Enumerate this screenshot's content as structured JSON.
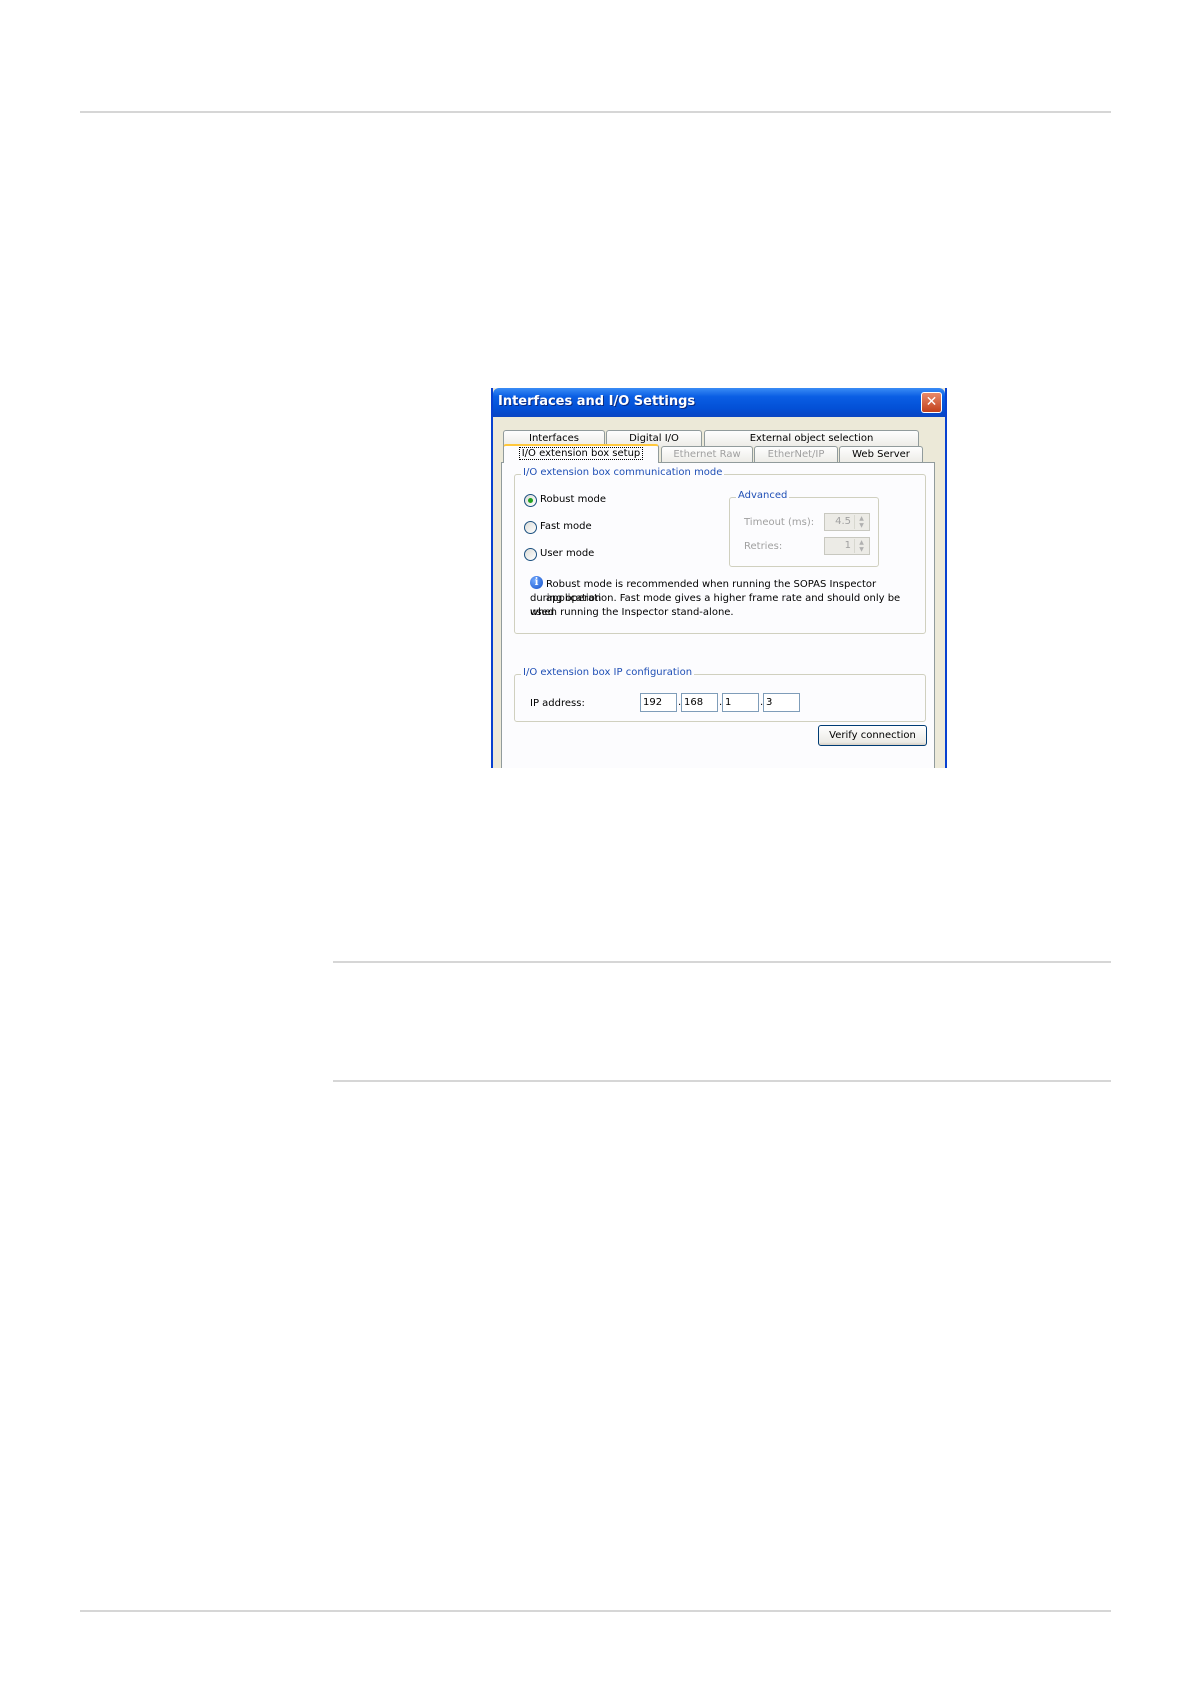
{
  "window": {
    "title": "Interfaces and I/O Settings",
    "close_glyph": "✕"
  },
  "tabs_row1": [
    "Interfaces",
    "Digital I/O",
    "External object selection"
  ],
  "tabs_row2": [
    {
      "label": "I/O extension box setup",
      "state": "active"
    },
    {
      "label": "Ethernet Raw",
      "state": "disabled"
    },
    {
      "label": "EtherNet/IP",
      "state": "disabled"
    },
    {
      "label": "Web Server",
      "state": "normal"
    }
  ],
  "comm_group": {
    "legend": "I/O extension box communication mode",
    "modes": [
      {
        "label": "Robust mode",
        "selected": true
      },
      {
        "label": "Fast mode",
        "selected": false
      },
      {
        "label": "User mode",
        "selected": false
      }
    ],
    "advanced": {
      "legend": "Advanced",
      "timeout_label": "Timeout (ms):",
      "timeout_value": "4.5",
      "retries_label": "Retries:",
      "retries_value": "1"
    },
    "info_text_lines": [
      "Robust mode is recommended when running the SOPAS Inspector application",
      "during operation. Fast mode gives a higher frame rate and should only be used",
      "when running the Inspector stand-alone."
    ]
  },
  "ip_group": {
    "legend": "I/O extension box IP configuration",
    "ip_label": "IP address:",
    "octets": [
      "192",
      "168",
      "1",
      "3"
    ]
  },
  "verify_button": "Verify connection",
  "colors": {
    "titlebar": "#0a5ee4",
    "legend_text": "#1f4fb5",
    "active_tab_accent": "#ffc83c",
    "radio_selected": "#21a121"
  }
}
